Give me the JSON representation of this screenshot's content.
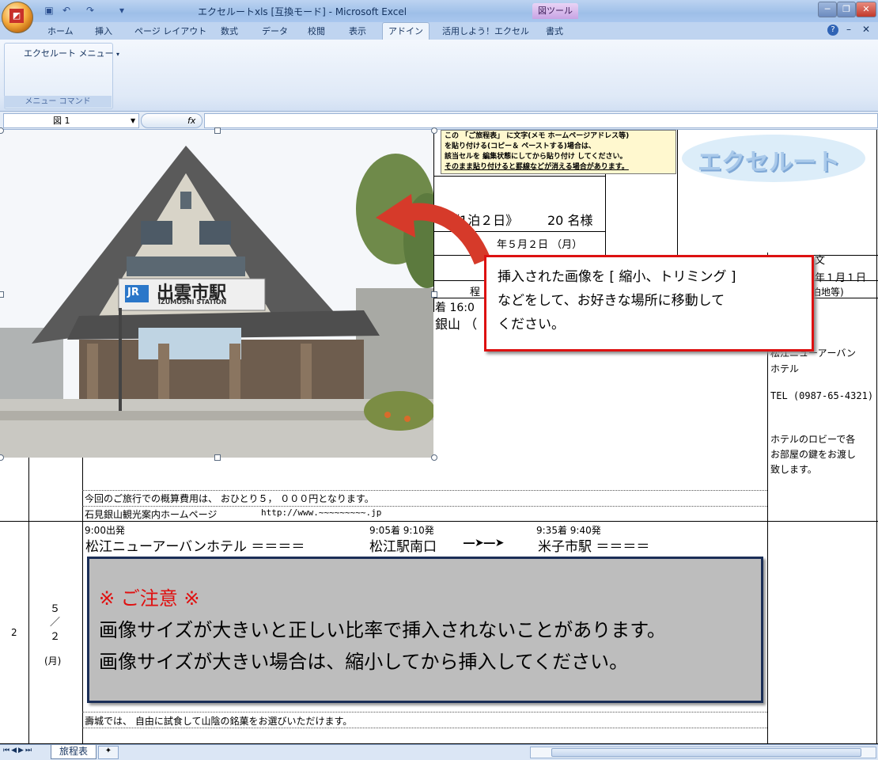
{
  "window": {
    "title": "エクセルートxls  [互換モード] - Microsoft Excel",
    "context_tab": "図ツール"
  },
  "ribbon": {
    "tabs": [
      "ホーム",
      "挿入",
      "ページ レイアウト",
      "数式",
      "データ",
      "校閲",
      "表示",
      "アドイン",
      "活用しよう！エクセル",
      "書式"
    ],
    "active_tab": "アドイン",
    "group_button": "エクセルート メニュー",
    "group_label": "メニュー コマンド"
  },
  "formula_bar": {
    "name_box": "図 1",
    "fx": "fx"
  },
  "sheet": {
    "memo_note": [
      "この 「ご旅程表」 に文字(メモ ホームページアドレス等)",
      "を貼り付ける(コピー＆ ペーストする)場合は、",
      "該当セルを  編集状態にしてから貼り付け  してください。",
      "そのまま貼り付けると罫線などが消える場合があります。"
    ],
    "logo": "エクセルート",
    "trip_length": "《1泊２日》",
    "guest_count": "20 名様",
    "date_partial": "年５月２日 （月）",
    "right_header": "文",
    "right_date": "年１月１日",
    "right_sub": "宿泊地等)",
    "itinerary_header": "程",
    "arrive_time": "着  16:0",
    "ginzan_partial": "銀山 （",
    "hotel_name_1": "松江ニューアーバン",
    "hotel_name_2": "ホテル",
    "hotel_tel": "TEL (0987-65-4321)",
    "lobby_note_1": "ホテルのロビーで各",
    "lobby_note_2": "お部屋の鍵をお渡し",
    "lobby_note_3": "致します。",
    "cost_note": "今回のご旅行での概算費用は、 おひとり５， ０００円となります。",
    "site_label": "石見銀山観光案内ホームページ",
    "site_url": "http://www.~~~~~~~~~.jp",
    "day2": {
      "row_no": "2",
      "month": "５",
      "slash": "／",
      "day": "２",
      "weekday": "(月)",
      "t1": "9:00出発",
      "t2": "9:05着  9:10発",
      "t3": "9:35着  9:40発",
      "route_a": "松江ニューアーバンホテル  ＝＝＝＝",
      "route_b": "松江駅南口",
      "route_c": "米子市駅  ＝＝＝＝",
      "sweets_note": "壽城では、 自由に試食して山陰の銘菓をお選びいただけます。"
    }
  },
  "callout": {
    "line1": "挿入された画像を  [ 縮小、トリミング ]",
    "line2": "などをして、お好きな場所に移動して",
    "line3": "ください。"
  },
  "caution": {
    "title": "※  ご注意  ※",
    "line1": "画像サイズが大きいと正しい比率で挿入されないことがあります。",
    "line2": "画像サイズが大きい場合は、縮小してから挿入してください。"
  },
  "photo": {
    "station_sign": "出雲市駅",
    "station_sign_en": "IZUMOSHI STATION",
    "jr": "JR"
  },
  "status": {
    "sheet_tab": "旅程表"
  }
}
